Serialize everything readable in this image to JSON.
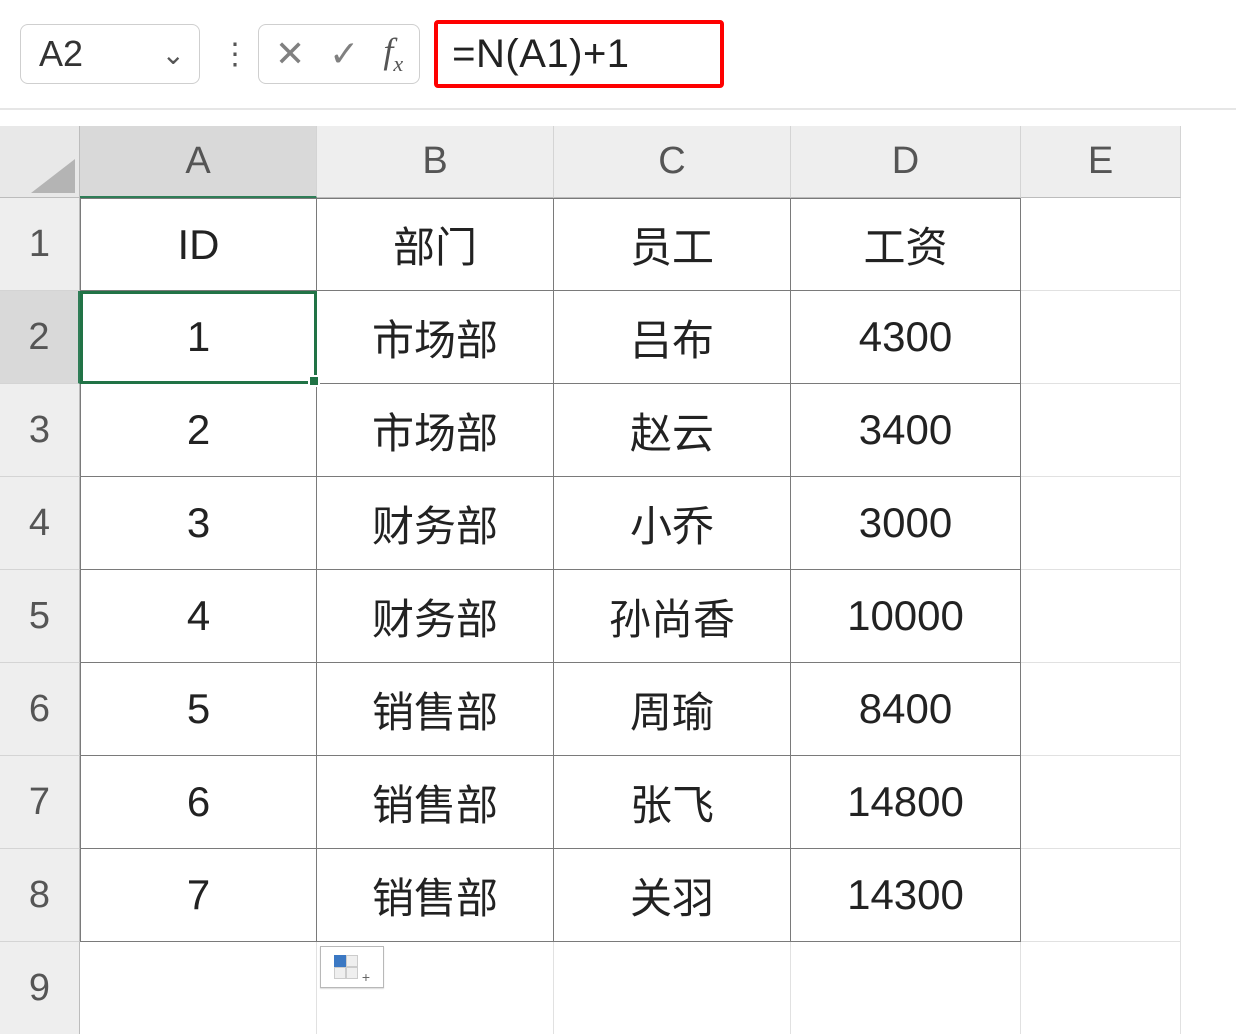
{
  "formula_bar": {
    "name_box": "A2",
    "formula": "=N(A1)+1"
  },
  "columns": [
    "A",
    "B",
    "C",
    "D",
    "E"
  ],
  "row_numbers": [
    "1",
    "2",
    "3",
    "4",
    "5",
    "6",
    "7",
    "8",
    "9"
  ],
  "selected_cell": "A2",
  "headers": {
    "id": "ID",
    "dept": "部门",
    "emp": "员工",
    "salary": "工资"
  },
  "rows": [
    {
      "id": "1",
      "dept": "市场部",
      "emp": "吕布",
      "salary": "4300"
    },
    {
      "id": "2",
      "dept": "市场部",
      "emp": "赵云",
      "salary": "3400"
    },
    {
      "id": "3",
      "dept": "财务部",
      "emp": "小乔",
      "salary": "3000"
    },
    {
      "id": "4",
      "dept": "财务部",
      "emp": "孙尚香",
      "salary": "10000"
    },
    {
      "id": "5",
      "dept": "销售部",
      "emp": "周瑜",
      "salary": "8400"
    },
    {
      "id": "6",
      "dept": "销售部",
      "emp": "张飞",
      "salary": "14800"
    },
    {
      "id": "7",
      "dept": "销售部",
      "emp": "关羽",
      "salary": "14300"
    }
  ]
}
